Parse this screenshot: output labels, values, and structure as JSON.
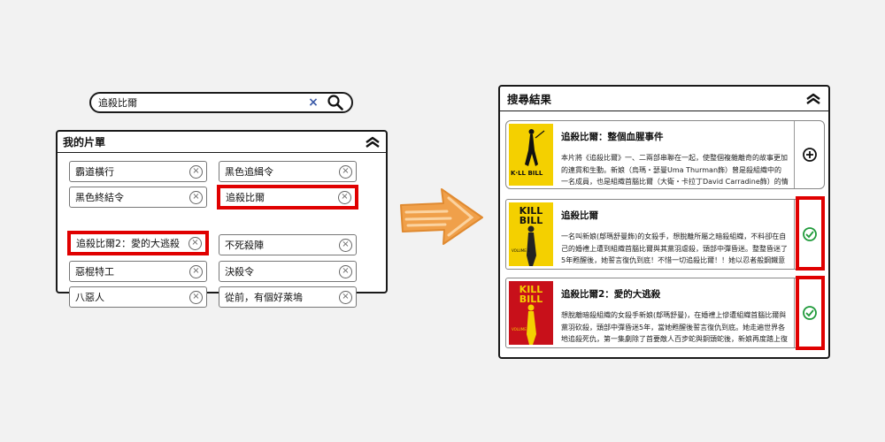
{
  "search": {
    "query": "追殺比爾",
    "clear_glyph": "×"
  },
  "my_list": {
    "title": "我的片單",
    "items": [
      {
        "label": "霸道橫行"
      },
      {
        "label": "黑色追緝令"
      },
      {
        "label": "黑色終結令"
      },
      {
        "label": "追殺比爾"
      },
      {
        "label": "追殺比爾2：愛的大逃殺"
      },
      {
        "label": "不死殺陣"
      },
      {
        "label": "惡棍特工"
      },
      {
        "label": "決殺令"
      },
      {
        "label": "八惡人"
      },
      {
        "label": "從前，有個好萊塢"
      }
    ],
    "remove_glyph": "×"
  },
  "results": {
    "title": "搜尋結果",
    "cards": [
      {
        "title": "追殺比爾：整個血腥事件",
        "desc": "本片將《追殺比爾》一、二兩部串聯在一起，使整個複雜離奇的故事更加的連貫和生動。新娘（烏瑪・瑟曼Uma Thurman飾）曾是殺組織中的一名成員，也是組織首腦比爾（大衛・卡拉丁David Carradine飾）的情人，金盆洗手後的她...",
        "action": "add-icon",
        "poster_text": "K·LL BILL"
      },
      {
        "title": "追殺比爾",
        "desc": "一名叫新娘(鄔瑪舒曼飾)的女殺手，想脫離所屬之暗殺組織，不料卻在自己的婚禮上遭到組織首腦比爾與其黨羽虐殺，頭部中彈昏迷。整整昏迷了5年甦醒後，她誓言復仇到底！不惜一切追殺比爾！！她以忍者般鋼鐵意志踏遍世界各地，一...",
        "action": "check-icon",
        "poster_text": "KILL BILL",
        "poster_sub": "VOLUME 1"
      },
      {
        "title": "追殺比爾2：愛的大逃殺",
        "desc": "想脫離暗殺組織的女殺手新娘(鄔瑪舒曼)，在婚禮上慘遭組織首腦比爾與黨羽砍殺，頭部中彈昏迷5年，當她甦醒後誓言復仇到底。她走遍世界各地追殺死仇，第一集劇除了首要敵人百步蛇與銅頭蛇後，新娘再度踏上復仇之路，以其人之...",
        "action": "check-icon",
        "poster_text": "KILL BILL",
        "poster_sub": "VOLUME 2"
      }
    ]
  },
  "colors": {
    "highlight": "#e00000",
    "check": "#1f9a3a",
    "arrow_fill": "#f0a04a",
    "poster_yellow": "#f4d000",
    "poster_red": "#c8101a"
  }
}
